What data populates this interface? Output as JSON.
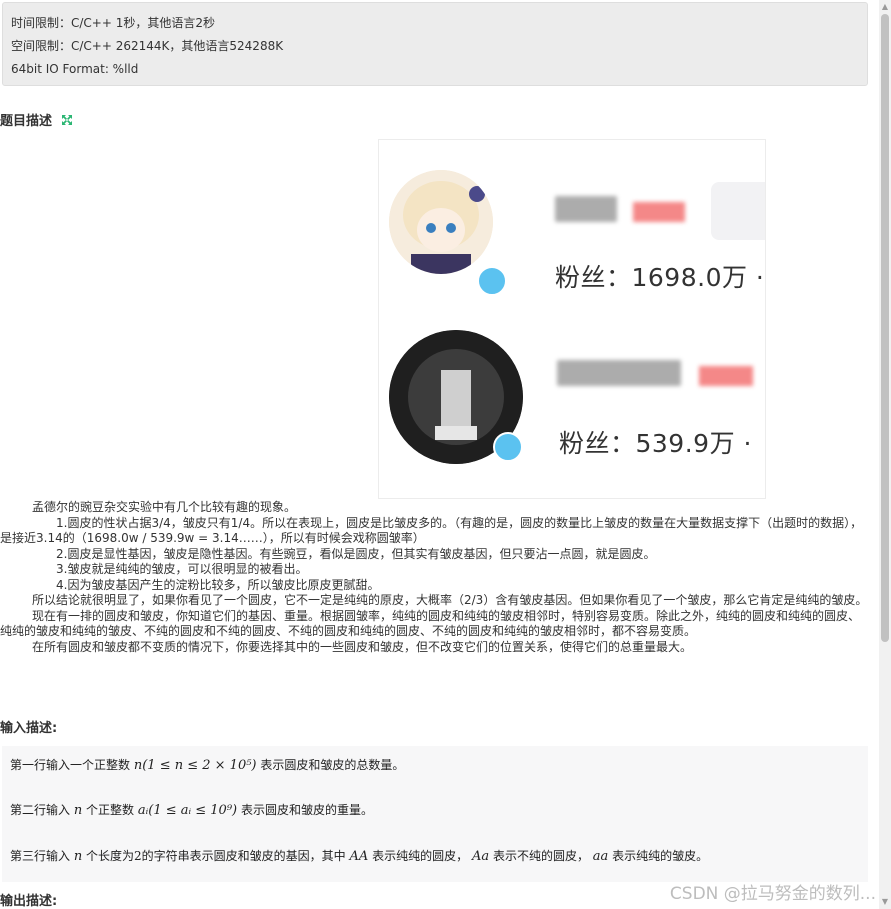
{
  "limits": {
    "time": "时间限制：C/C++ 1秒，其他语言2秒",
    "space": "空间限制：C/C++ 262144K，其他语言524288K",
    "io": "64bit IO Format: %lld"
  },
  "problem_title": "题目描述",
  "image_card": {
    "user1_fans": "粉丝：1698.0万 ·",
    "user2_fans": "粉丝：539.9万 ·"
  },
  "description": [
    "孟德尔的豌豆杂交实验中有几个比较有趣的现象。",
    "1.圆皮的性状占据3/4，皱皮只有1/4。所以在表现上，圆皮是比皱皮多的。（有趣的是，圆皮的数量比上皱皮的数量在大量数据支撑下（出题时的数据），是接近3.14的（1698.0w / 539.9w = 3.14……），所以有时候会戏称圆皱率）",
    "2.圆皮是显性基因，皱皮是隐性基因。有些豌豆，看似是圆皮，但其实有皱皮基因，但只要沾一点圆，就是圆皮。",
    "3.皱皮就是纯纯的皱皮，可以很明显的被看出。",
    "4.因为皱皮基因产生的淀粉比较多，所以皱皮比原皮更腻甜。",
    "所以结论就很明显了，如果你看见了一个圆皮，它不一定是纯纯的原皮，大概率（2/3）含有皱皮基因。但如果你看见了一个皱皮，那么它肯定是纯纯的皱皮。",
    "现在有一排的圆皮和皱皮，你知道它们的基因、重量。根据圆皱率，纯纯的圆皮和纯纯的皱皮相邻时，特别容易变质。除此之外，纯纯的圆皮和纯纯的圆皮、纯纯的皱皮和纯纯的皱皮、不纯的圆皮和不纯的圆皮、不纯的圆皮和纯纯的圆皮、不纯的圆皮和纯纯的皱皮相邻时，都不容易变质。",
    "在所有圆皮和皱皮都不变质的情况下，你要选择其中的一些圆皮和皱皮，但不改变它们的位置关系，使得它们的总重量最大。"
  ],
  "input_title": "输入描述:",
  "input_lines": {
    "l1_pre": "第一行输入一个正整数",
    "l1_math": "n(1 ≤ n ≤ 2 × 10⁵)",
    "l1_post": "表示圆皮和皱皮的总数量。",
    "l2_pre": "第二行输入",
    "l2_math1": "n",
    "l2_mid": "个正整数",
    "l2_math2": "aᵢ(1 ≤ aᵢ ≤ 10⁹)",
    "l2_post": "表示圆皮和皱皮的重量。",
    "l3_pre": "第三行输入",
    "l3_math1": "n",
    "l3_mid": "个长度为2的字符串表示圆皮和皱皮的基因，其中",
    "l3_math2": "AA",
    "l3_mid2": "表示纯纯的圆皮，",
    "l3_math3": "Aa",
    "l3_mid3": "表示不纯的圆皮，",
    "l3_math4": "aa",
    "l3_post": "表示纯纯的皱皮。"
  },
  "output_title": "输出描述:",
  "watermark": "CSDN @拉马努金的数列...",
  "colors": {
    "expand_icon": "#2bb673",
    "verify_badge": "#5bc2f0"
  }
}
